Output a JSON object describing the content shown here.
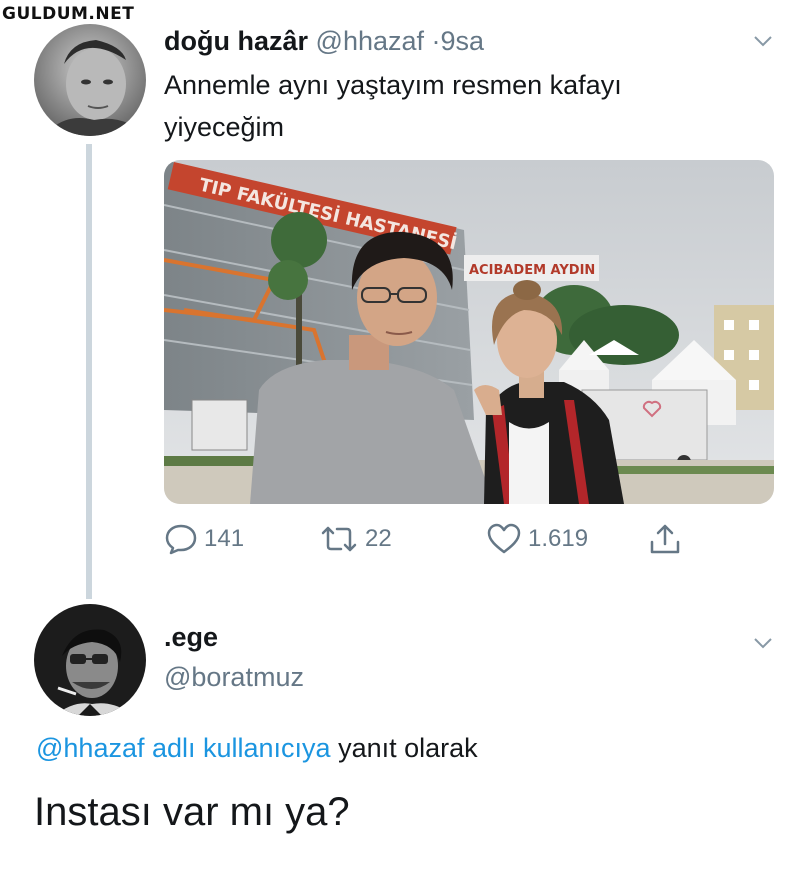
{
  "watermark": "GULDUM.NET",
  "tweet": {
    "display_name": "doğu hazâr",
    "handle": "@hhazaf",
    "separator": "·",
    "time": "9sa",
    "text": "Annemle aynı yaştayım resmen kafayı yiyeceğim",
    "photo_signs": {
      "building_sign": "TIP FAKÜLTESİ HASTANESİ",
      "banner_sign": "ACIBADEM AYDIN"
    },
    "actions": {
      "replies": "141",
      "retweets": "22",
      "likes": "1.619"
    },
    "icons": [
      "reply-icon",
      "retweet-icon",
      "like-icon",
      "share-icon",
      "chevron-down-icon"
    ]
  },
  "reply": {
    "display_name": ".ege",
    "handle": "@boratmuz",
    "replying_to_link": "@hhazaf adlı kullanıcıya",
    "replying_to_suffix": "yanıt olarak",
    "text": "Instası var mı ya?"
  },
  "colors": {
    "link": "#1b95e0",
    "muted": "#657786",
    "thread_line": "#ccd6dd"
  }
}
